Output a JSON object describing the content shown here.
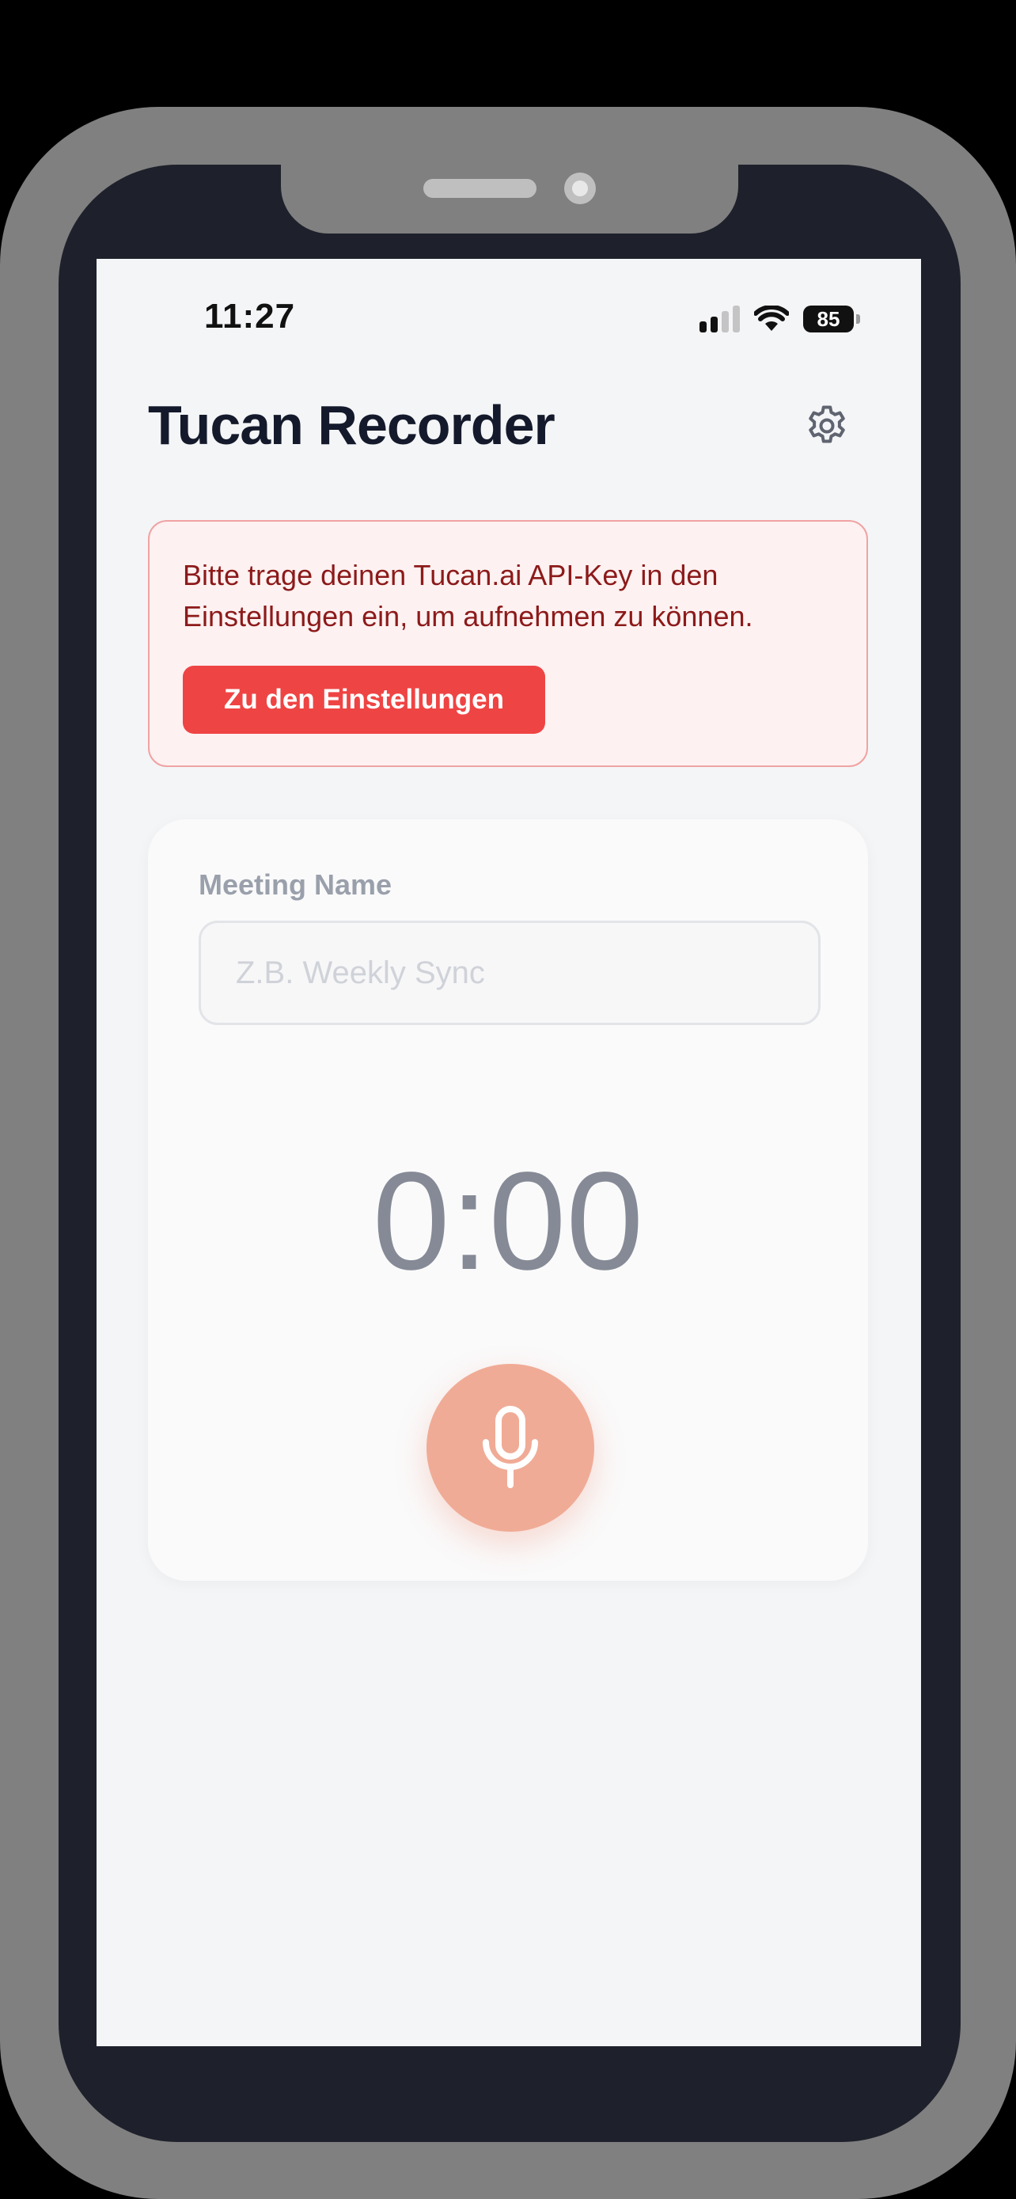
{
  "status_bar": {
    "time": "11:27",
    "battery": "85",
    "signal_icon": "cellular-signal-icon",
    "wifi_icon": "wifi-icon"
  },
  "header": {
    "title": "Tucan Recorder",
    "settings_icon": "gear-icon"
  },
  "alert": {
    "message": "Bitte trage deinen Tucan.ai API-Key in den Einstellungen ein, um aufnehmen zu können.",
    "button_label": "Zu den Einstellungen"
  },
  "recorder": {
    "meeting_label": "Meeting Name",
    "meeting_placeholder": "Z.B. Weekly Sync",
    "meeting_value": "",
    "timer": "0:00",
    "record_icon": "microphone-icon"
  },
  "colors": {
    "accent_alert": "#ef4444",
    "record_button": "#f0ab96",
    "title": "#141a2b"
  }
}
